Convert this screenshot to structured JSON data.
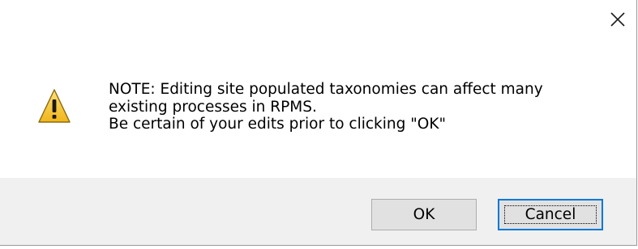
{
  "dialog": {
    "close_glyph": "✕",
    "icon": "warning-triangle-icon",
    "message_lines": [
      "NOTE:  Editing site populated taxonomies can affect many",
      "existing processes in RPMS.",
      "Be certain of your edits prior to clicking \"OK\""
    ],
    "buttons": {
      "ok_label": "OK",
      "cancel_label": "Cancel"
    }
  },
  "colors": {
    "footer_bg": "#f0f0f0",
    "button_face": "#e1e1e1",
    "default_button_border": "#0078d7",
    "warning_yellow": "#f6c21b"
  }
}
